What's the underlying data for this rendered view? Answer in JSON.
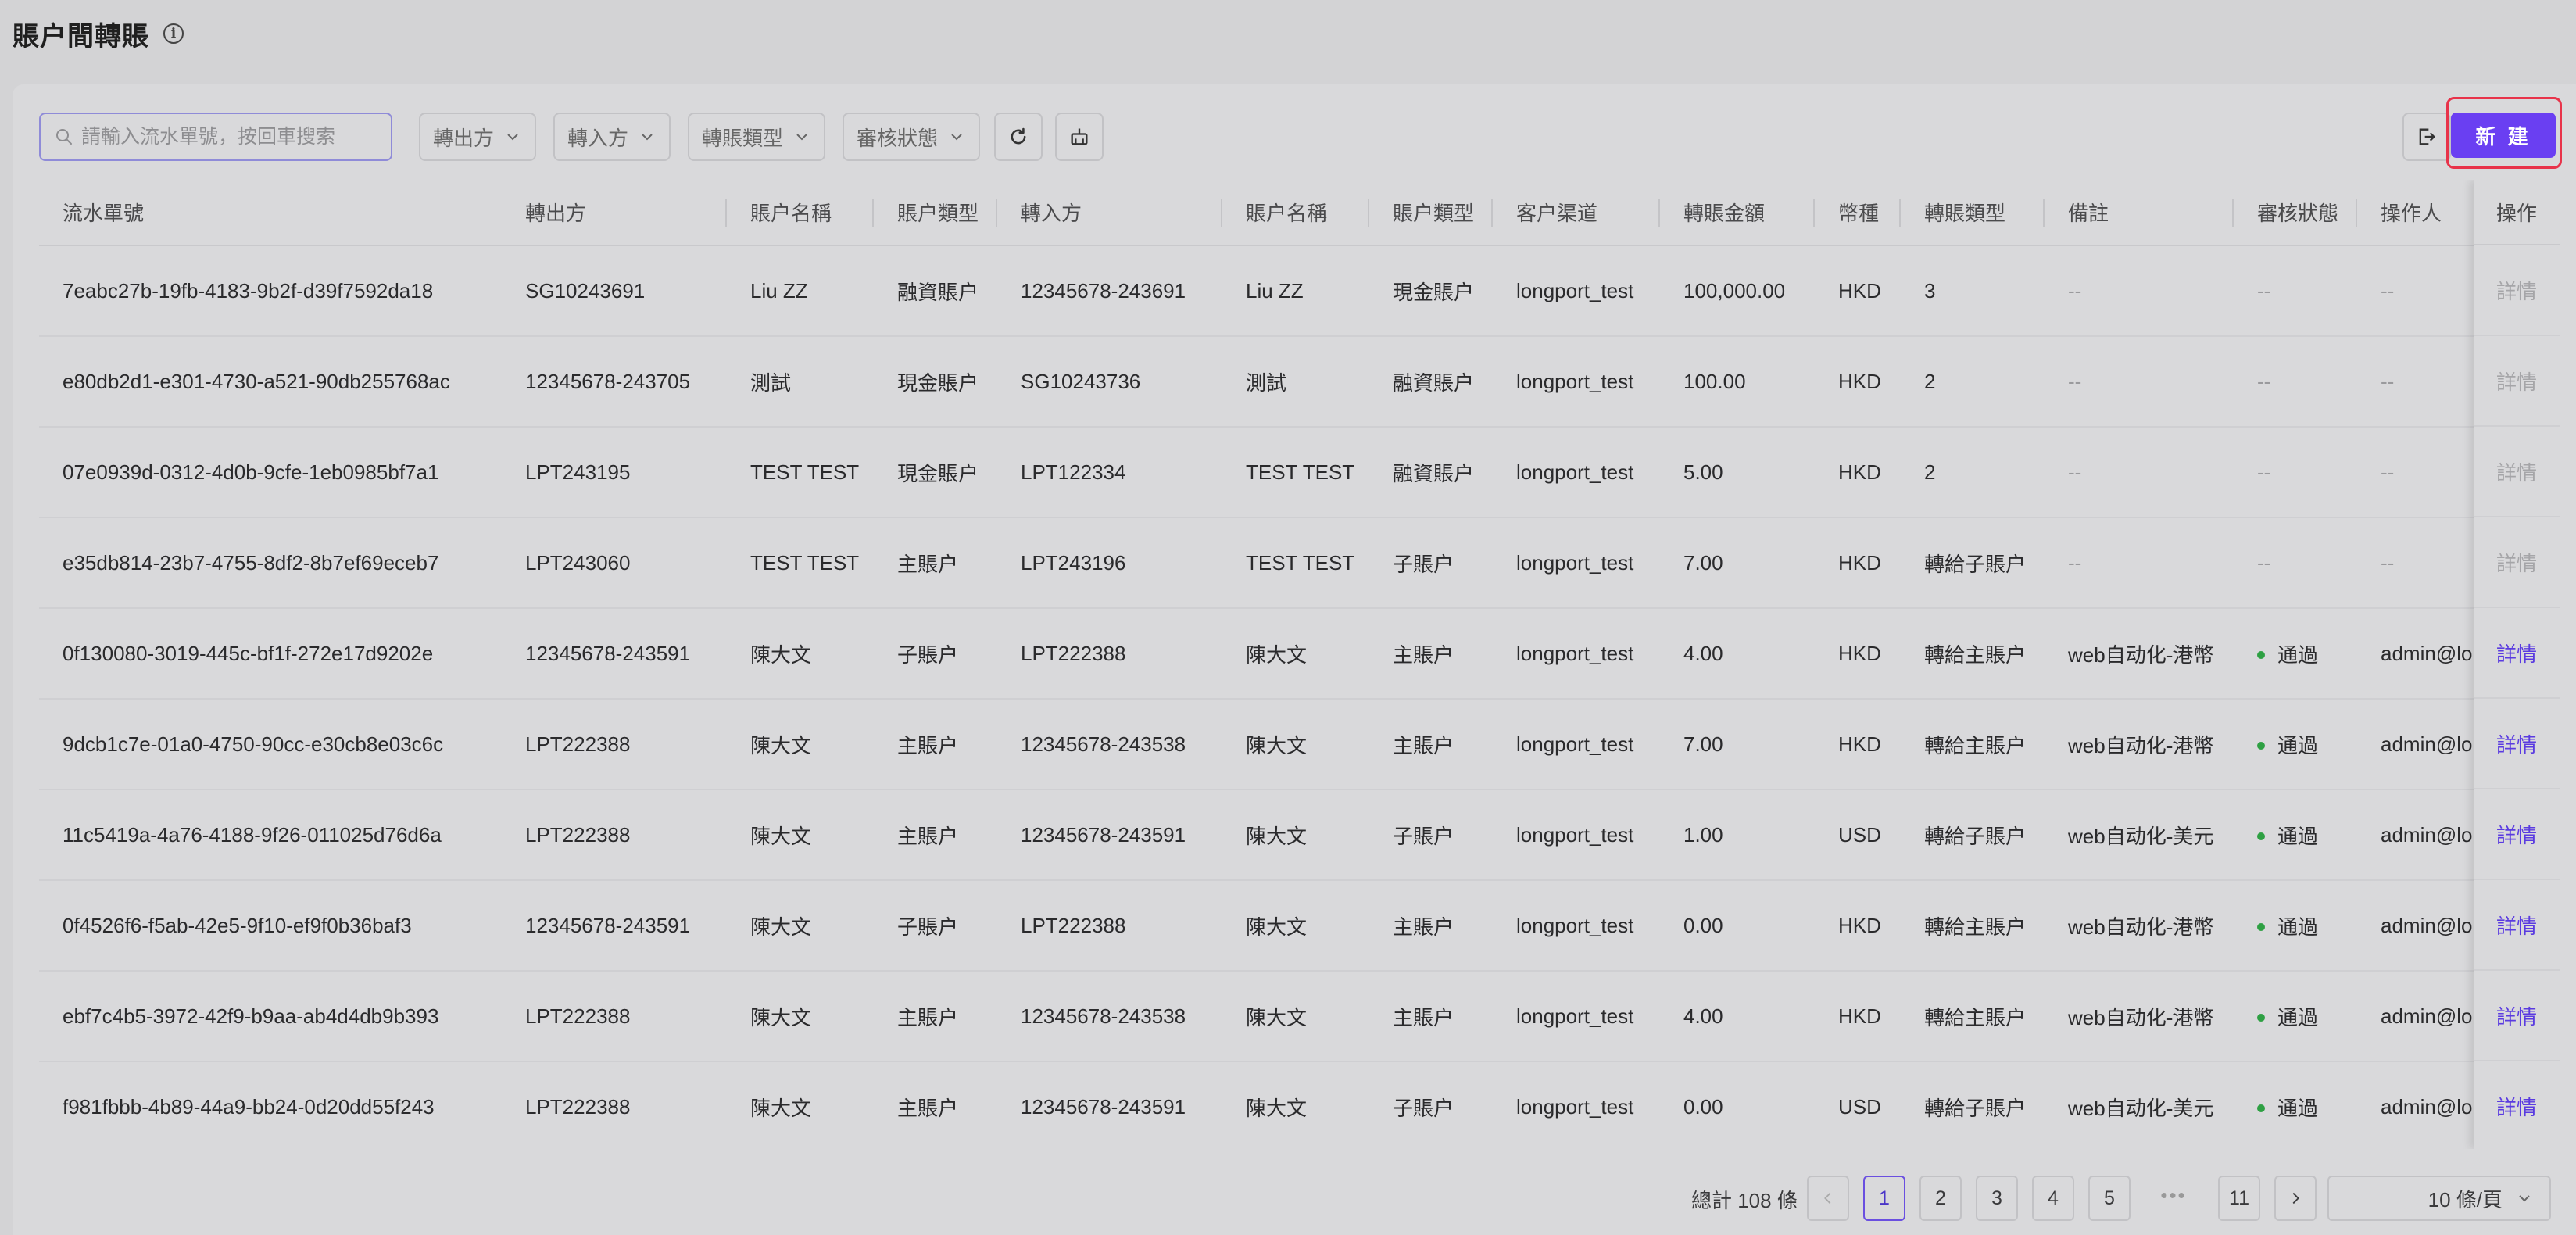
{
  "page": {
    "title": "賬户間轉賬"
  },
  "toolbar": {
    "search_placeholder": "請輸入流水單號，按回車搜索",
    "filters": [
      "轉出方",
      "轉入方",
      "轉賬類型",
      "審核狀態"
    ],
    "new_label": "新 建"
  },
  "table": {
    "columns": [
      "流水單號",
      "轉出方",
      "賬户名稱",
      "賬户類型",
      "轉入方",
      "賬户名稱",
      "賬户類型",
      "客户渠道",
      "轉賬金額",
      "幣種",
      "轉賬類型",
      "備註",
      "審核狀態",
      "操作人",
      "操作"
    ],
    "rows": [
      [
        "7eabc27b-19fb-4183-9b2f-d39f7592da18",
        "SG10243691",
        "Liu ZZ",
        "融資賬户",
        "12345678-243691",
        "Liu ZZ",
        "現金賬户",
        "longport_test",
        "100,000.00",
        "HKD",
        "3",
        "--",
        "--",
        "--",
        "詳情"
      ],
      [
        "e80db2d1-e301-4730-a521-90db255768ac",
        "12345678-243705",
        "測試",
        "現金賬户",
        "SG10243736",
        "測試",
        "融資賬户",
        "longport_test",
        "100.00",
        "HKD",
        "2",
        "--",
        "--",
        "--",
        "詳情"
      ],
      [
        "07e0939d-0312-4d0b-9cfe-1eb0985bf7a1",
        "LPT243195",
        "TEST TEST",
        "現金賬户",
        "LPT122334",
        "TEST TEST",
        "融資賬户",
        "longport_test",
        "5.00",
        "HKD",
        "2",
        "--",
        "--",
        "--",
        "詳情"
      ],
      [
        "e35db814-23b7-4755-8df2-8b7ef69eceb7",
        "LPT243060",
        "TEST TEST",
        "主賬户",
        "LPT243196",
        "TEST TEST",
        "子賬户",
        "longport_test",
        "7.00",
        "HKD",
        "轉給子賬户",
        "--",
        "--",
        "--",
        "詳情"
      ],
      [
        "0f130080-3019-445c-bf1f-272e17d9202e",
        "12345678-243591",
        "陳大文",
        "子賬户",
        "LPT222388",
        "陳大文",
        "主賬户",
        "longport_test",
        "4.00",
        "HKD",
        "轉給主賬户",
        "web自动化-港幣",
        "通過",
        "admin@lo",
        "詳情"
      ],
      [
        "9dcb1c7e-01a0-4750-90cc-e30cb8e03c6c",
        "LPT222388",
        "陳大文",
        "主賬户",
        "12345678-243538",
        "陳大文",
        "主賬户",
        "longport_test",
        "7.00",
        "HKD",
        "轉給主賬户",
        "web自动化-港幣",
        "通過",
        "admin@lo",
        "詳情"
      ],
      [
        "11c5419a-4a76-4188-9f26-011025d76d6a",
        "LPT222388",
        "陳大文",
        "主賬户",
        "12345678-243591",
        "陳大文",
        "子賬户",
        "longport_test",
        "1.00",
        "USD",
        "轉給子賬户",
        "web自动化-美元",
        "通過",
        "admin@lo",
        "詳情"
      ],
      [
        "0f4526f6-f5ab-42e5-9f10-ef9f0b36baf3",
        "12345678-243591",
        "陳大文",
        "子賬户",
        "LPT222388",
        "陳大文",
        "主賬户",
        "longport_test",
        "0.00",
        "HKD",
        "轉給主賬户",
        "web自动化-港幣",
        "通過",
        "admin@lo",
        "詳情"
      ],
      [
        "ebf7c4b5-3972-42f9-b9aa-ab4d4db9b393",
        "LPT222388",
        "陳大文",
        "主賬户",
        "12345678-243538",
        "陳大文",
        "主賬户",
        "longport_test",
        "4.00",
        "HKD",
        "轉給主賬户",
        "web自动化-港幣",
        "通過",
        "admin@lo",
        "詳情"
      ],
      [
        "f981fbbb-4b89-44a9-bb24-0d20dd55f243",
        "LPT222388",
        "陳大文",
        "主賬户",
        "12345678-243591",
        "陳大文",
        "子賬户",
        "longport_test",
        "0.00",
        "USD",
        "轉給子賬户",
        "web自动化-美元",
        "通過",
        "admin@lo",
        "詳情"
      ]
    ]
  },
  "pagination": {
    "total_label": "總計 108 條",
    "pages": [
      "1",
      "2",
      "3",
      "4",
      "5"
    ],
    "ellipsis": "•••",
    "last_page": "11",
    "current_page": "1",
    "page_size_label": "10 條/頁"
  },
  "colors": {
    "accent": "#6a3ff2",
    "highlight_border": "#e8334a",
    "status_ok": "#2ea043",
    "link": "#5a3be0"
  }
}
